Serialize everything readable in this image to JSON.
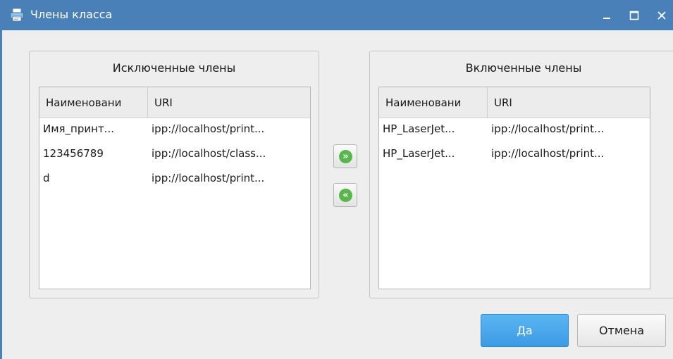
{
  "window": {
    "title": "Члены класса",
    "icon": "printer-icon",
    "controls": [
      "minimize-icon",
      "maximize-icon",
      "close-icon"
    ]
  },
  "excluded": {
    "title": "Исключенные члены",
    "columns": {
      "name": "Наименовани",
      "uri": "URI"
    },
    "rows": [
      {
        "name": "Имя_принт...",
        "uri": "ipp://localhost/print..."
      },
      {
        "name": "123456789",
        "uri": "ipp://localhost/class..."
      },
      {
        "name": "d",
        "uri": "ipp://localhost/print..."
      }
    ]
  },
  "included": {
    "title": "Включенные члены",
    "columns": {
      "name": "Наименовани",
      "uri": "URI"
    },
    "rows": [
      {
        "name": "HP_LaserJet...",
        "uri": "ipp://localhost/print..."
      },
      {
        "name": "HP_LaserJet...",
        "uri": "ipp://localhost/print..."
      }
    ]
  },
  "transfer": {
    "add_label": "»",
    "remove_label": "«",
    "accent": "#58b74b"
  },
  "buttons": {
    "ok": "Да",
    "cancel": "Отмена",
    "ok_color": "#3b9be4"
  }
}
